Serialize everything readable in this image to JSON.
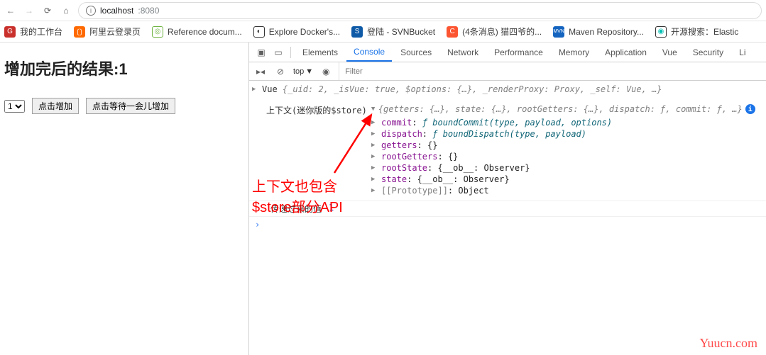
{
  "browser": {
    "url_host": "localhost",
    "url_port": ":8080",
    "info_tooltip": "i"
  },
  "bookmarks": [
    {
      "label": "我的工作台",
      "color": "#c9302c",
      "glyph": "G"
    },
    {
      "label": "阿里云登录页",
      "color": "#ff6a00",
      "glyph": "〔〕"
    },
    {
      "label": "Reference docum...",
      "color": "#6db33f",
      "glyph": "◎"
    },
    {
      "label": "Explore Docker's...",
      "color": "#0db7ed",
      "glyph": "◐"
    },
    {
      "label": "登陆 - SVNBucket",
      "color": "#0e5aa7",
      "glyph": "S"
    },
    {
      "label": "(4条消息) 猫四爷的...",
      "color": "#fc5531",
      "glyph": "C"
    },
    {
      "label": "Maven Repository...",
      "color": "#1565c0",
      "glyph": "MVN"
    },
    {
      "label": "开源搜索：Elastic",
      "color": "#00bfb3",
      "glyph": "◉"
    }
  ],
  "page": {
    "heading_prefix": "增加完后的结果:",
    "heading_value": "1",
    "select_value": "1",
    "select_display": "1 ▾",
    "btn_add": "点击增加",
    "btn_wait_add": "点击等待一会儿增加"
  },
  "devtools": {
    "tabs": [
      "Elements",
      "Console",
      "Sources",
      "Network",
      "Performance",
      "Memory",
      "Application",
      "Vue",
      "Security",
      "Li"
    ],
    "active_tab": "Console",
    "filter_placeholder": "Filter",
    "scope": "top",
    "vue_summary_prefix": "Vue ",
    "vue_summary_body": "{_uid: 2, _isVue: true, $options: {…}, _renderProxy: Proxy, _self: Vue, …}",
    "ctx_label": "上下文(迷你版的$store)",
    "ctx_summary": "{getters: {…}, state: {…}, rootGetters: {…}, dispatch: ƒ, commit: ƒ, …}",
    "props": {
      "commit": {
        "key": "commit",
        "val": "ƒ boundCommit(type, payload, options)"
      },
      "dispatch": {
        "key": "dispatch",
        "val": "ƒ boundDispatch(type, payload)"
      },
      "getters": {
        "key": "getters",
        "val": "{}"
      },
      "rootGetters": {
        "key": "rootGetters",
        "val": "{}"
      },
      "rootState": {
        "key": "rootState",
        "val": "{__ob__: Observer}"
      },
      "state": {
        "key": "state",
        "val": "{__ob__: Observer}"
      },
      "proto": {
        "key": "[[Prototype]]",
        "val": "Object"
      }
    },
    "log2_label": "传递过来的值",
    "log2_val": "1",
    "prompt": "›"
  },
  "annotation": {
    "line1": "上下文也包含",
    "line2": "$store部分API"
  },
  "watermark": "Yuucn.com"
}
